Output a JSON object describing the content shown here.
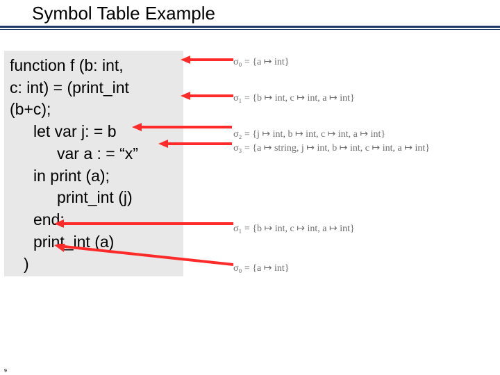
{
  "title": "Symbol Table Example",
  "code": {
    "l1": "function f (b: int,",
    "l2": "c: int) = (print_int",
    "l3": "(b+c);",
    "l4": "let var j: = b",
    "l5": "var a : = “x”",
    "l6": "in print (a);",
    "l7": "print_int (j)",
    "l8": "end;",
    "l9": "print_int (a)",
    "l10": ")"
  },
  "sigmas": {
    "s0a": "σ₀ = {a ↦ int}",
    "s1a": "σ₁ = {b ↦ int, c ↦ int, a ↦ int}",
    "s2": "σ₂ = {j ↦ int, b ↦ int, c ↦ int, a ↦ int}",
    "s3": "σ₃ = {a ↦ string, j ↦ int, b ↦ int, c ↦ int, a ↦ int}",
    "s1b": "σ₁ = {b ↦ int, c ↦ int, a ↦ int}",
    "s0b": "σ₀ = {a ↦ int}"
  },
  "page_number": "9"
}
